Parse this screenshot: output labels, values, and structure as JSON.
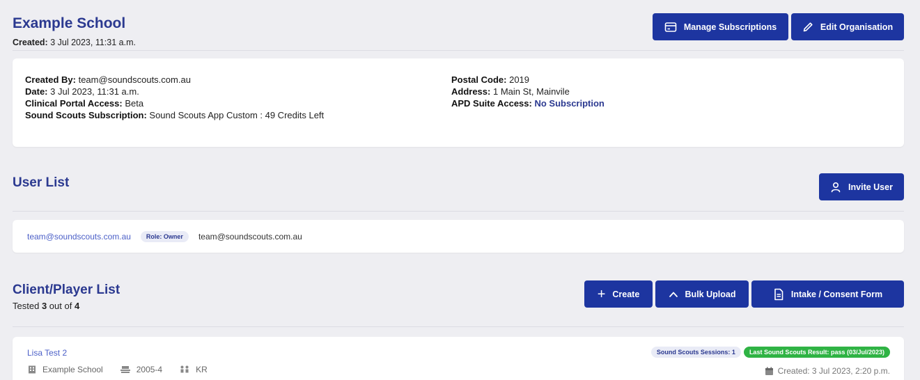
{
  "org": {
    "name": "Example School",
    "created_label": "Created:",
    "created_value": "3 Jul 2023, 11:31 a.m."
  },
  "header_buttons": {
    "manage_subscriptions": "Manage Subscriptions",
    "edit_organisation": "Edit Organisation"
  },
  "details": {
    "created_by_label": "Created By:",
    "created_by_value": "team@soundscouts.com.au",
    "date_label": "Date:",
    "date_value": "3 Jul 2023, 11:31 a.m.",
    "clinical_label": "Clinical Portal Access:",
    "clinical_value": "Beta",
    "subscription_label": "Sound Scouts Subscription:",
    "subscription_value": "Sound Scouts App Custom : 49 Credits Left",
    "postal_label": "Postal Code:",
    "postal_value": "2019",
    "address_label": "Address:",
    "address_value": "1 Main St, Mainvile",
    "apd_label": "APD Suite Access:",
    "apd_value": "No Subscription"
  },
  "user_list": {
    "title": "User List",
    "invite_button": "Invite User",
    "users": [
      {
        "email": "team@soundscouts.com.au",
        "role": "Role: Owner",
        "display": "team@soundscouts.com.au"
      }
    ]
  },
  "client_list": {
    "title": "Client/Player List",
    "tested_prefix": "Tested",
    "tested_count": "3",
    "tested_mid": "out of",
    "tested_total": "4",
    "buttons": {
      "create": "Create",
      "bulk_upload": "Bulk Upload",
      "intake": "Intake / Consent Form"
    },
    "clients": [
      {
        "name": "Lisa Test 2",
        "school": "Example School",
        "year": "2005-4",
        "class": "KR",
        "sessions": "Sound Scouts Sessions: 1",
        "result": "Last Sound Scouts Result: pass (03/Jul/2023)",
        "created": "Created: 3 Jul 2023, 2:20 p.m."
      }
    ]
  },
  "colors": {
    "primary": "#1d35a0",
    "title": "#2b3990",
    "link": "#4b5fc7",
    "success": "#2fb344",
    "background": "#eeeef2"
  }
}
